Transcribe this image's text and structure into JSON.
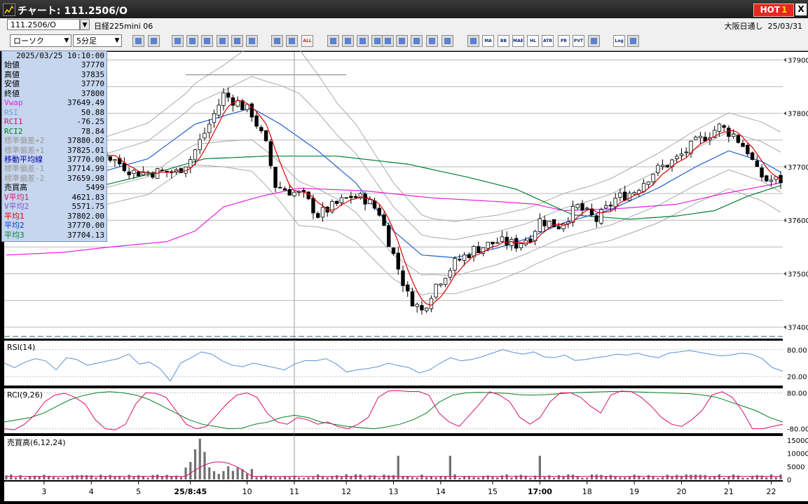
{
  "window": {
    "title": "チャート: 111.2506/O",
    "hot_label": "HOT",
    "hot_badge": "1",
    "close_label": "X"
  },
  "header": {
    "symbol": "111.2506/O",
    "instrument": "日経225mini 06",
    "session": "大阪日通し",
    "date": "25/03/31"
  },
  "toolbar": {
    "chart_type": "ローソク",
    "timeframe": "5分足",
    "icons": [
      "magnifier-icon",
      "window-icon",
      "pencil-icon",
      "eraser-icon",
      "cursor-icon",
      "undo-icon",
      "note-icon",
      "trash-icon",
      "indicator-icon",
      "indicator-remove-icon",
      "all-icon",
      "gear-icon",
      "tools-icon",
      "palette-icon",
      "color-icon",
      "import-icon",
      "search-chart-icon",
      "bars-icon",
      "cross-icon",
      "blank-icon",
      "table-icon",
      "ma-icon",
      "bb-icon",
      "mae-icon",
      "hl-icon",
      "atr-icon",
      "pr-icon",
      "pvt-icon",
      "frame-icon",
      "log-icon",
      "swap-icon"
    ],
    "button_texts": [
      "ALL",
      "MA",
      "BB",
      "MAE",
      "HL",
      "ATR",
      "PR",
      "PVT",
      "Log"
    ]
  },
  "info_panel": {
    "timestamp": "2025/03/25  10:10:00",
    "rows": [
      {
        "label": "始値",
        "value": "37770",
        "color": "#000000"
      },
      {
        "label": "高値",
        "value": "37835",
        "color": "#000000"
      },
      {
        "label": "安値",
        "value": "37770",
        "color": "#000000"
      },
      {
        "label": "終値",
        "value": "37800",
        "color": "#000000"
      },
      {
        "label": "Vwap",
        "value": "37649.49",
        "color": "#e81ee0"
      },
      {
        "label": "RSI",
        "value": "50.88",
        "color": "#6f9fe0"
      },
      {
        "label": "RCI1",
        "value": "-76.25",
        "color": "#d8106a"
      },
      {
        "label": "RCI2",
        "value": "78.84",
        "color": "#00801c"
      },
      {
        "label": "標準偏差+2",
        "value": "37880.02",
        "color": "#989898"
      },
      {
        "label": "標準偏差+1",
        "value": "37825.01",
        "color": "#989898"
      },
      {
        "label": "移動平均線",
        "value": "37770.00",
        "color": "#0000a0"
      },
      {
        "label": "標準偏差-1",
        "value": "37714.99",
        "color": "#989898"
      },
      {
        "label": "標準偏差-2",
        "value": "37659.98",
        "color": "#989898"
      },
      {
        "label": "売買高",
        "value": "5499",
        "color": "#000000"
      },
      {
        "label": "V平均1",
        "value": "4621.83",
        "color": "#d8106a"
      },
      {
        "label": "V平均2",
        "value": "5571.75",
        "color": "#8050d0"
      },
      {
        "label": "平均1",
        "value": "37802.00",
        "color": "#d80000"
      },
      {
        "label": "平均2",
        "value": "37770.00",
        "color": "#0040d0"
      },
      {
        "label": "平均3",
        "value": "37704.13",
        "color": "#008030"
      }
    ]
  },
  "chart_data": {
    "type": "candlestick",
    "price_axis": {
      "labels": [
        "37900",
        "37800",
        "37700",
        "37600",
        "37500",
        "37400"
      ],
      "values": [
        37900,
        37800,
        37700,
        37600,
        37500,
        37400
      ],
      "ylim": [
        37380,
        37915
      ]
    },
    "x_labels": [
      {
        "label": "3",
        "bar": 8
      },
      {
        "label": "4",
        "bar": 18
      },
      {
        "label": "5",
        "bar": 28
      },
      {
        "label": "25/8:45",
        "bar": 39,
        "bold": true
      },
      {
        "label": "10",
        "bar": 51
      },
      {
        "label": "11",
        "bar": 61
      },
      {
        "label": "12",
        "bar": 72
      },
      {
        "label": "13",
        "bar": 82
      },
      {
        "label": "14",
        "bar": 92
      },
      {
        "label": "15",
        "bar": 103
      },
      {
        "label": "17:00",
        "bar": 113,
        "bold": true
      },
      {
        "label": "18",
        "bar": 123
      },
      {
        "label": "19",
        "bar": 133
      },
      {
        "label": "20",
        "bar": 143
      },
      {
        "label": "21",
        "bar": 153
      },
      {
        "label": "22",
        "bar": 162
      }
    ],
    "bars": 165,
    "anchors": [
      [
        0,
        37695
      ],
      [
        10,
        37695
      ],
      [
        20,
        37728
      ],
      [
        27,
        37690
      ],
      [
        36,
        37690
      ],
      [
        39,
        37715
      ],
      [
        43,
        37780
      ],
      [
        46,
        37835
      ],
      [
        49,
        37820
      ],
      [
        52,
        37800
      ],
      [
        55,
        37740
      ],
      [
        57,
        37665
      ],
      [
        60,
        37655
      ],
      [
        63,
        37645
      ],
      [
        66,
        37610
      ],
      [
        69,
        37625
      ],
      [
        73,
        37645
      ],
      [
        76,
        37640
      ],
      [
        79,
        37615
      ],
      [
        82,
        37535
      ],
      [
        85,
        37460
      ],
      [
        88,
        37430
      ],
      [
        91,
        37480
      ],
      [
        95,
        37520
      ],
      [
        99,
        37545
      ],
      [
        104,
        37560
      ],
      [
        108,
        37555
      ],
      [
        111,
        37570
      ],
      [
        113,
        37600
      ],
      [
        117,
        37590
      ],
      [
        121,
        37625
      ],
      [
        125,
        37600
      ],
      [
        129,
        37640
      ],
      [
        133,
        37655
      ],
      [
        137,
        37690
      ],
      [
        142,
        37715
      ],
      [
        146,
        37745
      ],
      [
        151,
        37775
      ],
      [
        154,
        37760
      ],
      [
        157,
        37730
      ],
      [
        159,
        37690
      ],
      [
        161,
        37675
      ],
      [
        164,
        37675
      ]
    ],
    "sma": [
      [
        0,
        37670
      ],
      [
        20,
        37690
      ],
      [
        30,
        37715
      ],
      [
        40,
        37780
      ],
      [
        52,
        37810
      ],
      [
        58,
        37780
      ],
      [
        66,
        37730
      ],
      [
        74,
        37670
      ],
      [
        82,
        37580
      ],
      [
        88,
        37535
      ],
      [
        95,
        37530
      ],
      [
        104,
        37548
      ],
      [
        110,
        37565
      ],
      [
        118,
        37595
      ],
      [
        128,
        37620
      ],
      [
        138,
        37660
      ],
      [
        146,
        37700
      ],
      [
        153,
        37730
      ],
      [
        160,
        37710
      ],
      [
        164,
        37690
      ]
    ],
    "upper_band_offsets": [
      [
        0,
        55
      ],
      [
        38,
        70
      ],
      [
        46,
        95
      ],
      [
        55,
        130
      ],
      [
        62,
        165
      ],
      [
        70,
        120
      ],
      [
        82,
        90
      ],
      [
        90,
        70
      ],
      [
        100,
        65
      ],
      [
        112,
        55
      ],
      [
        124,
        55
      ],
      [
        138,
        65
      ],
      [
        150,
        70
      ],
      [
        164,
        75
      ]
    ],
    "long_ma": [
      [
        0,
        37615
      ],
      [
        18,
        37660
      ],
      [
        32,
        37690
      ],
      [
        42,
        37715
      ],
      [
        55,
        37720
      ],
      [
        70,
        37720
      ],
      [
        85,
        37705
      ],
      [
        98,
        37680
      ],
      [
        108,
        37658
      ],
      [
        120,
        37610
      ],
      [
        132,
        37602
      ],
      [
        142,
        37608
      ],
      [
        150,
        37618
      ],
      [
        157,
        37645
      ],
      [
        164,
        37665
      ]
    ],
    "vwap": [
      [
        0,
        37535
      ],
      [
        12,
        37540
      ],
      [
        22,
        37550
      ],
      [
        34,
        37560
      ],
      [
        40,
        37580
      ],
      [
        46,
        37625
      ],
      [
        54,
        37645
      ],
      [
        62,
        37660
      ],
      [
        76,
        37655
      ],
      [
        90,
        37642
      ],
      [
        104,
        37635
      ],
      [
        112,
        37630
      ],
      [
        118,
        37618
      ],
      [
        130,
        37622
      ],
      [
        142,
        37630
      ],
      [
        152,
        37650
      ],
      [
        164,
        37670
      ]
    ],
    "hline": {
      "value": 37872,
      "from_bar": 38,
      "to_bar": 72
    },
    "crosshair_bar": 61,
    "rsi": {
      "label": "RSI(14)",
      "axis": [
        "80.00",
        "20.00"
      ],
      "values": [
        50,
        40,
        52,
        60,
        55,
        35,
        62,
        58,
        45,
        50,
        55,
        60,
        70,
        48,
        52,
        38,
        10,
        50,
        62,
        75,
        70,
        55,
        45,
        42,
        50,
        45,
        40,
        35,
        48,
        56,
        55,
        60,
        48,
        30,
        35,
        38,
        42,
        50,
        44,
        40,
        28,
        35,
        50,
        62,
        55,
        58,
        64,
        72,
        80,
        74,
        70,
        75,
        64,
        62,
        68,
        56,
        58,
        62,
        65,
        70,
        68,
        72,
        66,
        62,
        72,
        75,
        78,
        74,
        70,
        66,
        68,
        72,
        70,
        60,
        40,
        32
      ]
    },
    "rci": {
      "label": "RCI(9,26)",
      "axis": [
        "80.00",
        "-80.00"
      ],
      "rci1": [
        -80,
        -85,
        -60,
        -20,
        40,
        70,
        78,
        60,
        30,
        -40,
        -80,
        -85,
        -60,
        30,
        80,
        78,
        60,
        0,
        -60,
        -80,
        -70,
        -20,
        30,
        70,
        80,
        60,
        -10,
        -50,
        -60,
        -30,
        -40,
        -60,
        -50,
        -70,
        -80,
        -60,
        -30,
        60,
        88,
        90,
        86,
        86,
        70,
        -10,
        -50,
        -70,
        -20,
        30,
        85,
        70,
        40,
        -30,
        -60,
        -30,
        40,
        80,
        80,
        60,
        20,
        -10,
        70,
        88,
        86,
        60,
        20,
        -30,
        -60,
        -70,
        -40,
        0,
        70,
        85,
        60,
        0,
        -80,
        -80,
        -70,
        -60
      ],
      "rci2": [
        -50,
        -40,
        -30,
        -10,
        20,
        50,
        68,
        80,
        85,
        80,
        70,
        50,
        20,
        -10,
        -40,
        -60,
        -70,
        -80,
        -78,
        -60,
        -50,
        -30,
        -20,
        -30,
        -50,
        -60,
        -70,
        -75,
        -80,
        -72,
        -60,
        -40,
        -10,
        40,
        70,
        80,
        82,
        80,
        78,
        72,
        70,
        72,
        76,
        80,
        82,
        84,
        86,
        86,
        84,
        82,
        80,
        78,
        76,
        70,
        60,
        40,
        20,
        0,
        -30,
        -50
      ]
    },
    "volume": {
      "label": "売買高(6,12,24)",
      "axis": [
        "15000",
        "10000",
        "5000",
        "0"
      ]
    }
  }
}
